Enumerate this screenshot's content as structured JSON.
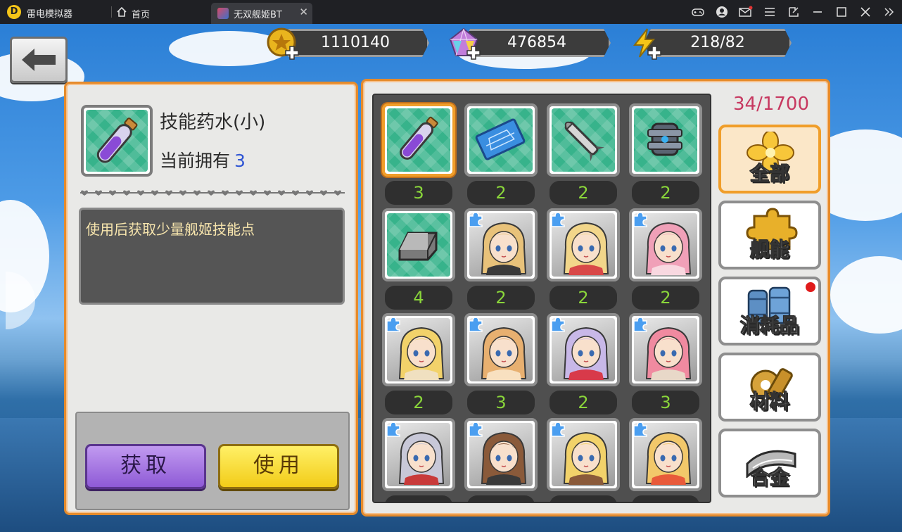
{
  "titlebar": {
    "app_name": "雷电模拟器",
    "home_tab": "首页",
    "game_tab": "无双舰姬BT",
    "close_glyph": "✕"
  },
  "resources": {
    "gold": "1110140",
    "gems": "476854",
    "energy": "218/82"
  },
  "detail": {
    "item_name": "技能药水(小)",
    "owned_label": "当前拥有",
    "owned_count": "3",
    "description": "使用后获取少量舰姬技能点",
    "get_button": "获取",
    "use_button": "使用"
  },
  "inventory": {
    "capacity": "34/1700",
    "items": [
      {
        "icon": "potion-icon",
        "count": "3",
        "selected": true
      },
      {
        "icon": "blueprint-icon",
        "count": "2"
      },
      {
        "icon": "missile-icon",
        "count": "2"
      },
      {
        "icon": "module-icon",
        "count": "2"
      },
      {
        "icon": "metal-ingot-icon",
        "count": "4"
      },
      {
        "icon": "character-fragment-icon",
        "count": "2"
      },
      {
        "icon": "character-fragment-icon",
        "count": "2"
      },
      {
        "icon": "character-fragment-icon",
        "count": "2"
      },
      {
        "icon": "character-fragment-icon",
        "count": "2"
      },
      {
        "icon": "character-fragment-icon",
        "count": "3"
      },
      {
        "icon": "character-fragment-icon",
        "count": "2"
      },
      {
        "icon": "character-fragment-icon",
        "count": "3"
      },
      {
        "icon": "character-fragment-icon",
        "count": ""
      },
      {
        "icon": "character-fragment-icon",
        "count": ""
      },
      {
        "icon": "character-fragment-icon",
        "count": ""
      },
      {
        "icon": "character-fragment-icon",
        "count": ""
      }
    ]
  },
  "categories": [
    {
      "label": "全部",
      "icon": "flower-icon",
      "active": true
    },
    {
      "label": "舰能",
      "icon": "puzzle-icon"
    },
    {
      "label": "消耗品",
      "icon": "barrels-icon",
      "badge": true
    },
    {
      "label": "材料",
      "icon": "gear-icon"
    },
    {
      "label": "合金",
      "icon": "alloy-icon"
    }
  ],
  "colors": {
    "panel_border": "#e58b2c",
    "count_text": "#8ad63a",
    "capacity_text": "#c73860",
    "owned_number": "#2f55d4"
  }
}
